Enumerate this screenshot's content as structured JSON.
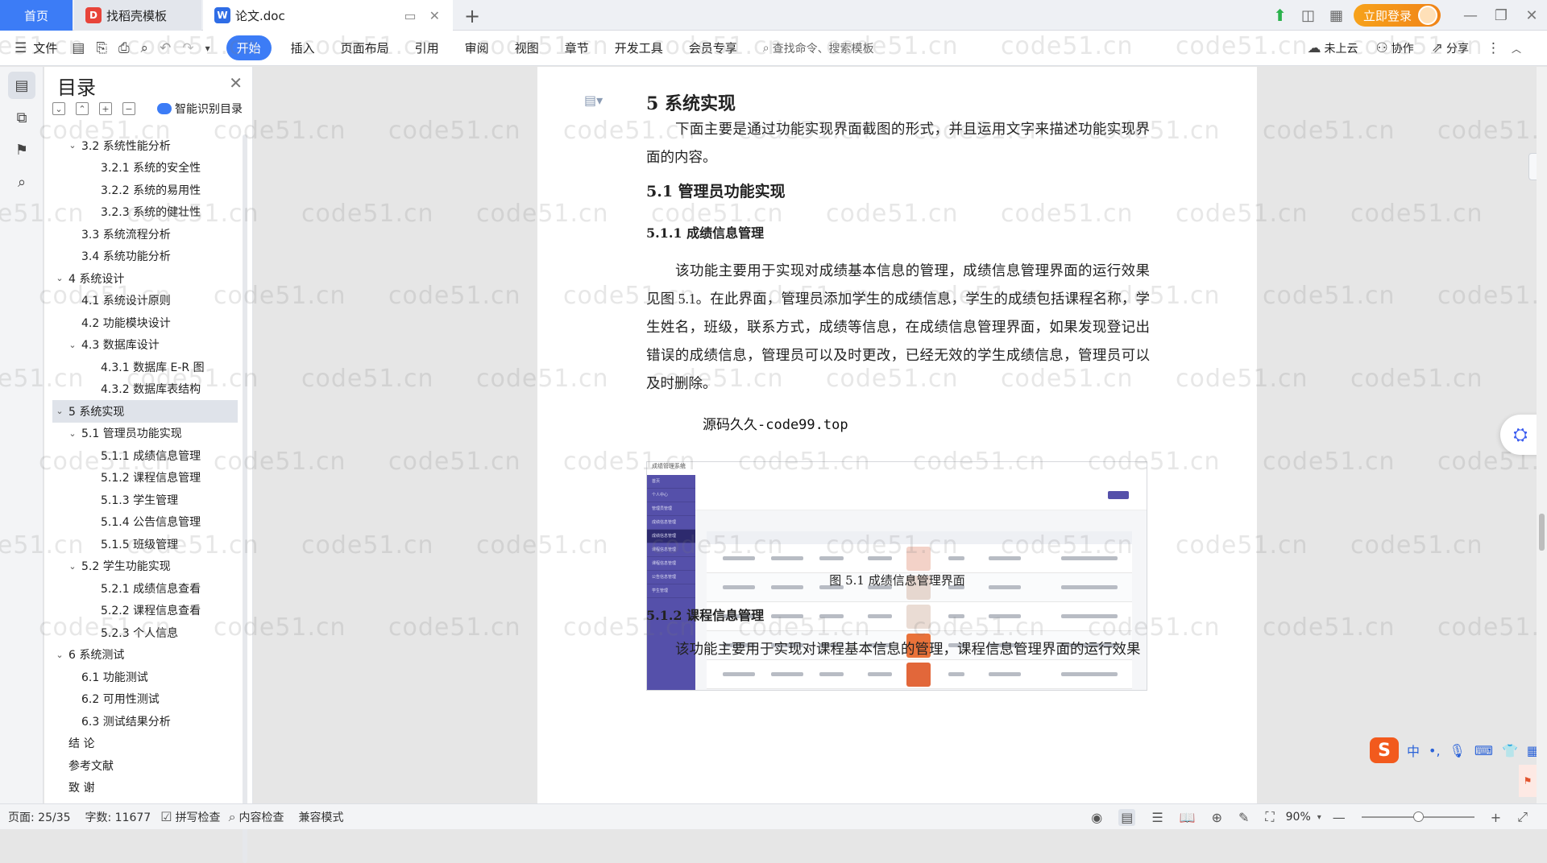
{
  "tabs": {
    "home": "首页",
    "templates": "找稻壳模板",
    "doc": "论文.doc"
  },
  "title_right": {
    "login": "立即登录"
  },
  "menu": {
    "file": "文件",
    "items": [
      "开始",
      "插入",
      "页面布局",
      "引用",
      "审阅",
      "视图",
      "章节",
      "开发工具",
      "会员专享"
    ],
    "search_placeholder": "查找命令、搜索模板",
    "cloud": "未上云",
    "collab": "协作",
    "share": "分享"
  },
  "toc": {
    "title": "目录",
    "smart": "智能识别目录",
    "items": [
      {
        "text": "3.2  系统性能分析",
        "level": 2,
        "arrow": true
      },
      {
        "text": "3.2.1  系统的安全性",
        "level": 3
      },
      {
        "text": "3.2.2  系统的易用性",
        "level": 3
      },
      {
        "text": "3.2.3  系统的健壮性",
        "level": 3
      },
      {
        "text": "3.3  系统流程分析",
        "level": 2
      },
      {
        "text": "3.4  系统功能分析",
        "level": 2
      },
      {
        "text": "4  系统设计",
        "level": 1,
        "arrow": true
      },
      {
        "text": "4.1  系统设计原则",
        "level": 2
      },
      {
        "text": "4.2  功能模块设计",
        "level": 2
      },
      {
        "text": "4.3  数据库设计",
        "level": 2,
        "arrow": true
      },
      {
        "text": "4.3.1  数据库 E-R 图",
        "level": 3
      },
      {
        "text": "4.3.2  数据库表结构",
        "level": 3
      },
      {
        "text": "5  系统实现",
        "level": 1,
        "arrow": true,
        "selected": true
      },
      {
        "text": "5.1  管理员功能实现",
        "level": 2,
        "arrow": true
      },
      {
        "text": "5.1.1  成绩信息管理",
        "level": 3
      },
      {
        "text": "5.1.2  课程信息管理",
        "level": 3
      },
      {
        "text": "5.1.3  学生管理",
        "level": 3
      },
      {
        "text": "5.1.4  公告信息管理",
        "level": 3
      },
      {
        "text": "5.1.5  班级管理",
        "level": 3
      },
      {
        "text": "5.2  学生功能实现",
        "level": 2,
        "arrow": true
      },
      {
        "text": "5.2.1  成绩信息查看",
        "level": 3
      },
      {
        "text": "5.2.2  课程信息查看",
        "level": 3
      },
      {
        "text": "5.2.3  个人信息",
        "level": 3
      },
      {
        "text": "6  系统测试",
        "level": 1,
        "arrow": true
      },
      {
        "text": "6.1  功能测试",
        "level": 2
      },
      {
        "text": "6.2  可用性测试",
        "level": 2
      },
      {
        "text": "6.3  测试结果分析",
        "level": 2
      },
      {
        "text": "结    论",
        "level": 1
      },
      {
        "text": "参考文献",
        "level": 1
      },
      {
        "text": "致    谢",
        "level": 1
      }
    ]
  },
  "document": {
    "h1": "5  系统实现",
    "intro": "下面主要是通过功能实现界面截图的形式，并且运用文字来描述功能实现界面的内容。",
    "h2": "5.1  管理员功能实现",
    "h3a": "5.1.1  成绩信息管理",
    "para1": "该功能主要用于实现对成绩基本信息的管理，成绩信息管理界面的运行效果见图 5.1。在此界面，管理员添加学生的成绩信息，学生的成绩包括课程名称，学生姓名，班级，联系方式，成绩等信息，在成绩信息管理界面，如果发现登记出错误的成绩信息，管理员可以及时更改，已经无效的学生成绩信息，管理员可以及时删除。",
    "overlay": "源码久久-code99.top",
    "caption": "图 5.1  成绩信息管理界面",
    "h3b": "5.1.2  课程信息管理",
    "para2": "该功能主要用于实现对课程基本信息的管理，课程信息管理界面的运行效果"
  },
  "screenshot": {
    "app_title": "成绩管理系统",
    "sidebar": [
      "首页",
      "个人中心",
      "管理员管理",
      "成绩信息管理",
      "成绩信息管理",
      "课程信息管理",
      "课程信息管理",
      "公告信息管理",
      "学生管理"
    ]
  },
  "watermark": "code51.cn",
  "status": {
    "page": "页面: 25/35",
    "words": "字数: 11677",
    "spell": "拼写检查",
    "content": "内容检查",
    "compat": "兼容模式",
    "zoom": "90%",
    "zoom_level": 0.5
  }
}
